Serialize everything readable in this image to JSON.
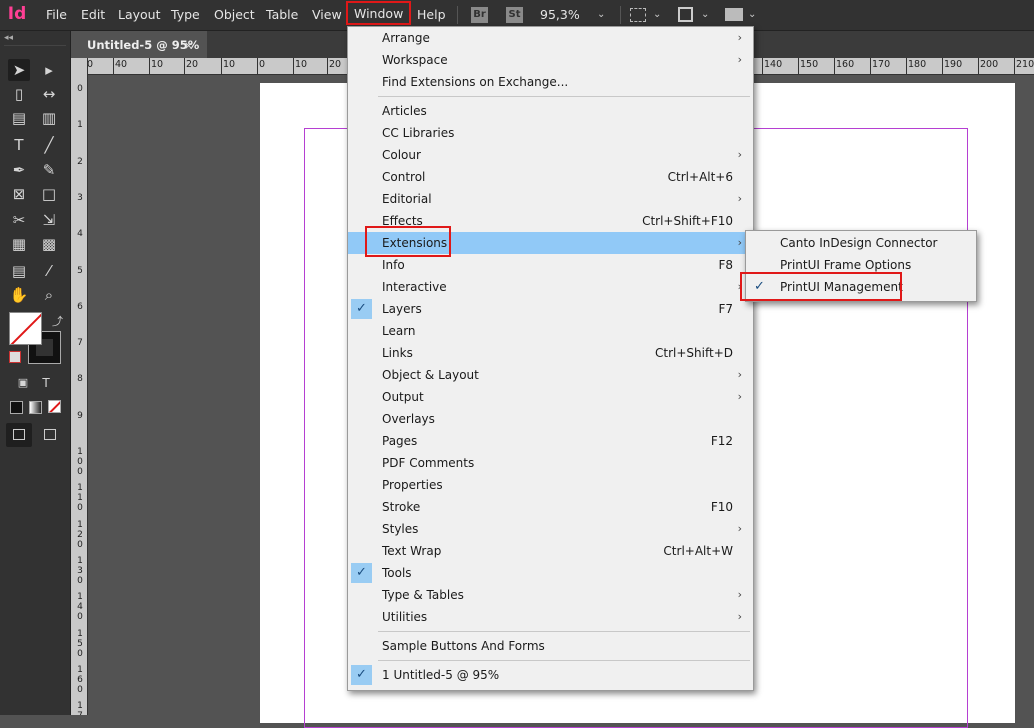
{
  "app": {
    "logo_text": "Id"
  },
  "menubar": {
    "items": [
      "File",
      "Edit",
      "Layout",
      "Type",
      "Object",
      "Table",
      "View",
      "Window",
      "Help"
    ],
    "bridge_badge": "Br",
    "stock_badge": "St",
    "zoom": "95,3%"
  },
  "document_tab": {
    "title": "Untitled-5 @ 95%",
    "close_glyph": "×"
  },
  "ruler": {
    "h_labels": [
      "0",
      "40",
      "10",
      "20",
      "10",
      "0",
      "10",
      "20",
      "140",
      "150",
      "160",
      "170",
      "180",
      "190",
      "200",
      "210"
    ],
    "v_labels": [
      "0",
      "1",
      "2",
      "3",
      "4",
      "5",
      "6",
      "7",
      "8",
      "9",
      "1\n0\n0",
      "1\n1\n0",
      "1\n2\n0",
      "1\n3\n0",
      "1\n4\n0",
      "1\n5\n0",
      "1\n6\n0",
      "1\n7"
    ]
  },
  "window_menu": {
    "items": [
      {
        "label": "Arrange",
        "submenu": true
      },
      {
        "label": "Workspace",
        "submenu": true
      },
      {
        "label": "Find Extensions on Exchange..."
      },
      {
        "separator": true
      },
      {
        "label": "Articles"
      },
      {
        "label": "CC Libraries"
      },
      {
        "label": "Colour",
        "submenu": true
      },
      {
        "label": "Control",
        "shortcut": "Ctrl+Alt+6"
      },
      {
        "label": "Editorial",
        "submenu": true
      },
      {
        "label": "Effects",
        "shortcut": "Ctrl+Shift+F10"
      },
      {
        "label": "Extensions",
        "submenu": true,
        "highlighted": true
      },
      {
        "label": "Info",
        "shortcut": "F8"
      },
      {
        "label": "Interactive",
        "submenu": true
      },
      {
        "label": "Layers",
        "shortcut": "F7",
        "checked": true
      },
      {
        "label": "Learn"
      },
      {
        "label": "Links",
        "shortcut": "Ctrl+Shift+D"
      },
      {
        "label": "Object & Layout",
        "submenu": true
      },
      {
        "label": "Output",
        "submenu": true
      },
      {
        "label": "Overlays"
      },
      {
        "label": "Pages",
        "shortcut": "F12"
      },
      {
        "label": "PDF Comments"
      },
      {
        "label": "Properties"
      },
      {
        "label": "Stroke",
        "shortcut": "F10"
      },
      {
        "label": "Styles",
        "submenu": true
      },
      {
        "label": "Text Wrap",
        "shortcut": "Ctrl+Alt+W"
      },
      {
        "label": "Tools",
        "checked": true
      },
      {
        "label": "Type & Tables",
        "submenu": true
      },
      {
        "label": "Utilities",
        "submenu": true
      },
      {
        "separator": true
      },
      {
        "label": "Sample Buttons And Forms"
      },
      {
        "separator": true
      },
      {
        "label": "1 Untitled-5 @ 95%",
        "checked": true
      }
    ]
  },
  "extensions_submenu": {
    "items": [
      {
        "label": "Canto InDesign Connector"
      },
      {
        "label": "PrintUI Frame Options"
      },
      {
        "label": "PrintUI Management",
        "checked": true
      }
    ]
  },
  "glyphs": {
    "arrow": "›",
    "check": "✓",
    "chevron": "⌄"
  },
  "colors": {
    "highlight": "#91c9f7",
    "callout": "#e01818",
    "menu_bg": "#f0f0f0",
    "brand": "#ff3f94"
  }
}
